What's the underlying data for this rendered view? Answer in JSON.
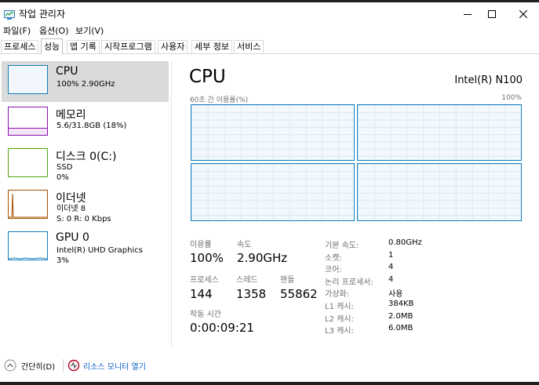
{
  "window": {
    "title": "작업 관리자",
    "app_icon": "task-manager-icon",
    "controls": [
      "minimize-icon",
      "maximize-icon",
      "close-icon"
    ]
  },
  "menu": [
    "파일(F)",
    "옵션(O)",
    "보기(V)"
  ],
  "tabs": [
    "프로세스",
    "성능",
    "앱 기록",
    "시작프로그램",
    "사용자",
    "세부 정보",
    "서비스"
  ],
  "active_tab": "성능",
  "sidebar": [
    {
      "title": "CPU",
      "lines": [
        "100% 2.90GHz"
      ],
      "color": "#117dbb"
    },
    {
      "title": "메모리",
      "lines": [
        "5.6/31.8GB (18%)"
      ],
      "color": "#8b12ae"
    },
    {
      "title": "디스크 0(C:)",
      "lines": [
        "SSD",
        "0%"
      ],
      "color": "#4da60c"
    },
    {
      "title": "이더넷",
      "lines": [
        "이더넷 8",
        "S: 0 R: 0 Kbps"
      ],
      "color": "#a74f01"
    },
    {
      "title": "GPU 0",
      "lines": [
        "Intel(R) UHD Graphics",
        "3%"
      ],
      "color": "#117dbb"
    }
  ],
  "main": {
    "title": "CPU",
    "processor": "Intel(R) N100",
    "graph_caption": "60초 간 이용률(%)",
    "graph_max": "100%",
    "utilization_level": 1.0,
    "stats": {
      "usage_label": "이용률",
      "usage": "100%",
      "speed_label": "속도",
      "speed": "2.90GHz",
      "processes_label": "프로세스",
      "processes": "144",
      "threads_label": "스레드",
      "threads": "1358",
      "handles_label": "핸들",
      "handles": "55862",
      "uptime_label": "작동 시간",
      "uptime": "0:00:09:21"
    },
    "info": [
      {
        "label": "기본 속도:",
        "value": "0.80GHz"
      },
      {
        "label": "소켓:",
        "value": "1"
      },
      {
        "label": "코어:",
        "value": "4"
      },
      {
        "label": "논리 프로세서:",
        "value": "4"
      },
      {
        "label": "가상화:",
        "value": "사용"
      },
      {
        "label": "L1 캐시:",
        "value": "384KB"
      },
      {
        "label": "L2 캐시:",
        "value": "2.0MB"
      },
      {
        "label": "L3 캐시:",
        "value": "6.0MB"
      }
    ]
  },
  "footer": {
    "collapse": "간단히(D)",
    "resource_monitor": "리소스 모니터 열기"
  }
}
